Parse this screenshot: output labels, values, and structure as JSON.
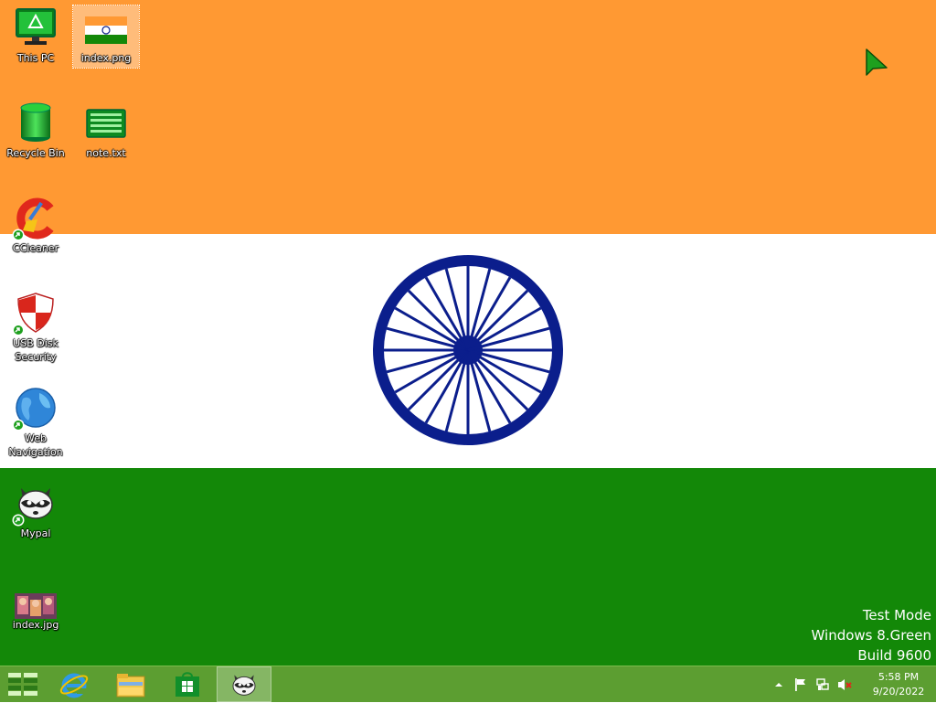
{
  "wallpaper": {
    "name": "india-flag",
    "colors": {
      "saffron": "#ff9933",
      "white": "#ffffff",
      "green": "#138808",
      "chakra": "#0b1e8c"
    }
  },
  "desktop_icons": [
    {
      "label": "This PC",
      "icon": "computer-icon"
    },
    {
      "label": "index.png",
      "icon": "png-image-icon",
      "selected": true
    },
    {
      "label": "Recycle Bin",
      "icon": "recycle-bin-icon"
    },
    {
      "label": "note.txt",
      "icon": "text-file-icon"
    },
    {
      "label": "CCleaner",
      "icon": "ccleaner-icon",
      "shortcut": true
    },
    {
      "label": "USB Disk Security",
      "icon": "shield-icon",
      "shortcut": true
    },
    {
      "label": "Web Navigation",
      "icon": "globe-icon",
      "shortcut": true
    },
    {
      "label": "Mypal",
      "icon": "raccoon-icon",
      "shortcut": true
    },
    {
      "label": "index.jpg",
      "icon": "jpg-image-icon"
    }
  ],
  "watermark": {
    "line1": "Test Mode",
    "line2": "Windows 8.Green",
    "line3": "Build 9600"
  },
  "taskbar": {
    "color": "#5c9e31",
    "items": [
      "start-icon",
      "internet-explorer-icon",
      "file-explorer-icon",
      "store-icon",
      "mypal-icon"
    ],
    "active_item": "mypal-icon",
    "tray_icons": [
      "show-hidden-icons-chevron",
      "action-center-flag-icon",
      "network-icon",
      "volume-muted-icon"
    ],
    "clock": {
      "time": "5:58 PM",
      "date": "9/20/2022"
    }
  },
  "cursor": {
    "icon": "arrow-cursor-icon",
    "color": "#1ea01e"
  }
}
